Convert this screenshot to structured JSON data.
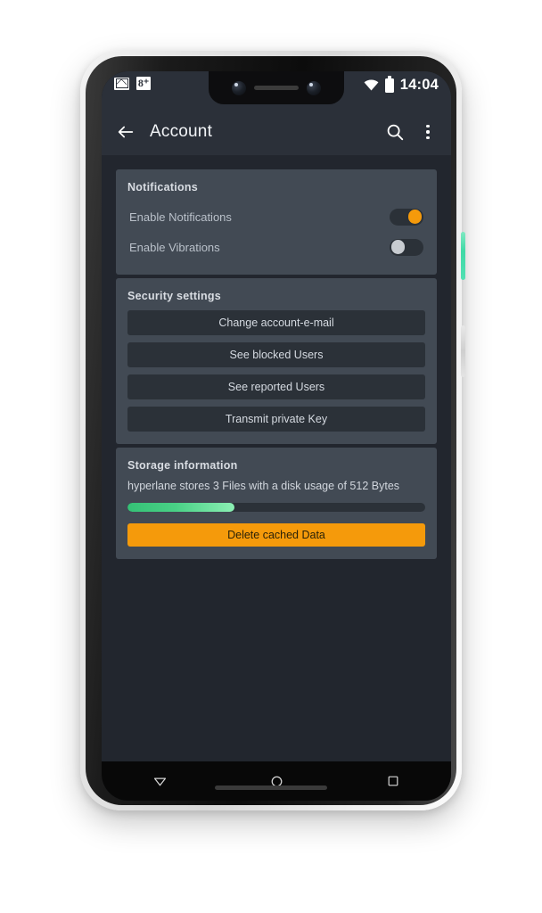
{
  "status_bar": {
    "left_icons": [
      {
        "name": "gmail-icon",
        "label": "Gmail"
      },
      {
        "name": "google-plus-icon",
        "label": "g+",
        "glyph": "8⁺"
      }
    ],
    "right_icons": [
      {
        "name": "wifi-icon",
        "label": "Wi-Fi"
      },
      {
        "name": "battery-icon",
        "label": "Battery"
      }
    ],
    "time": "14:04"
  },
  "app_bar": {
    "back_label": "Back",
    "title": "Account",
    "search_label": "Search",
    "overflow_label": "More options"
  },
  "cards": {
    "notifications": {
      "title": "Notifications",
      "rows": [
        {
          "label": "Enable Notifications",
          "state": "on"
        },
        {
          "label": "Enable Vibrations",
          "state": "off"
        }
      ]
    },
    "security": {
      "title": "Security settings",
      "buttons": [
        {
          "label": "Change account-e-mail"
        },
        {
          "label": "See blocked Users"
        },
        {
          "label": "See reported Users"
        },
        {
          "label": "Transmit private Key"
        }
      ]
    },
    "storage": {
      "title": "Storage information",
      "description": "hyperlane stores 3 Files with a disk usage of 512 Bytes",
      "progress_percent": 36,
      "delete_button_label": "Delete cached Data"
    }
  },
  "nav_bar": {
    "back_label": "Back",
    "home_label": "Home",
    "recents_label": "Recent apps"
  },
  "colors": {
    "accent_orange": "#f59a0b",
    "progress_green": "#49d186",
    "card_bg": "#424a54",
    "screen_bg": "#22262e",
    "bar_bg": "#2b3039",
    "inset_bg": "#2b3138",
    "power_button_teal": "#52e0b3"
  }
}
